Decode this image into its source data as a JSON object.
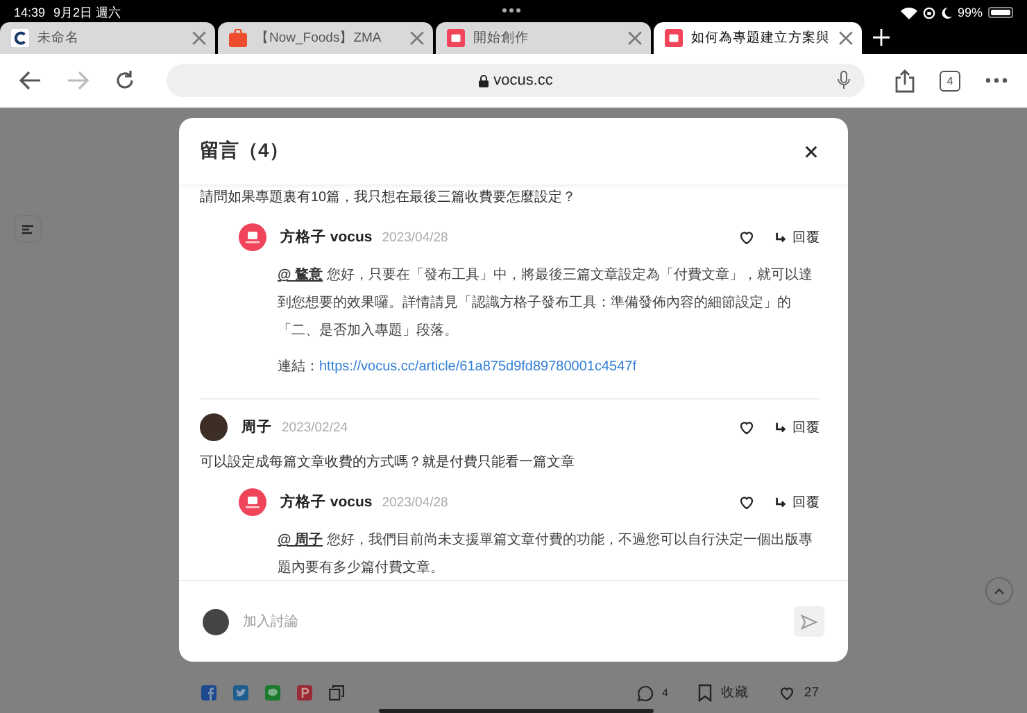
{
  "status_bar": {
    "time": "14:39",
    "date": "9月2日 週六",
    "battery": "99%"
  },
  "browser": {
    "tabs": [
      {
        "title": "未命名",
        "kind": "c",
        "selected": false
      },
      {
        "title": "【Now_Foods】ZMA",
        "kind": "shop",
        "selected": false
      },
      {
        "title": "開始創作",
        "kind": "vocus",
        "selected": false
      },
      {
        "title": "如何為專題建立方案與",
        "kind": "vocus",
        "selected": true
      }
    ],
    "url": "vocus.cc",
    "tab_count": "4"
  },
  "modal": {
    "title": "留言（4）",
    "comments": [
      {
        "kind": "tail",
        "text": "請問如果專題裏有10篇，我只想在最後三篇收費要怎麼設定？",
        "replies": [
          {
            "author": "方格子 vocus",
            "date": "2023/04/28",
            "reply_label": "回覆",
            "mention": "@ 鶩意",
            "text": "您好，只要在「發布工具」中，將最後三篇文章設定為「付費文章」，就可以達到您想要的效果囉。詳情請見「認識方格子發布工具：準備發佈內容的細節設定」的「二、是否加入專題」段落。",
            "link_label": "連結：",
            "link": "https://vocus.cc/article/61a875d9fd89780001c4547f"
          }
        ]
      },
      {
        "kind": "full",
        "author": "周子",
        "date": "2023/02/24",
        "reply_label": "回覆",
        "text": "可以設定成每篇文章收費的方式嗎？就是付費只能看一篇文章",
        "replies": [
          {
            "author": "方格子 vocus",
            "date": "2023/04/28",
            "reply_label": "回覆",
            "mention": "@ 周子",
            "text": "您好，我們目前尚未支援單篇文章付費的功能，不過您可以自行決定一個出版專題內要有多少篇付費文章。"
          }
        ]
      }
    ],
    "composer": {
      "placeholder": "加入討論"
    }
  },
  "bottom_bar": {
    "comment_count": "4",
    "bookmark_label": "收藏",
    "like_count": "27"
  }
}
